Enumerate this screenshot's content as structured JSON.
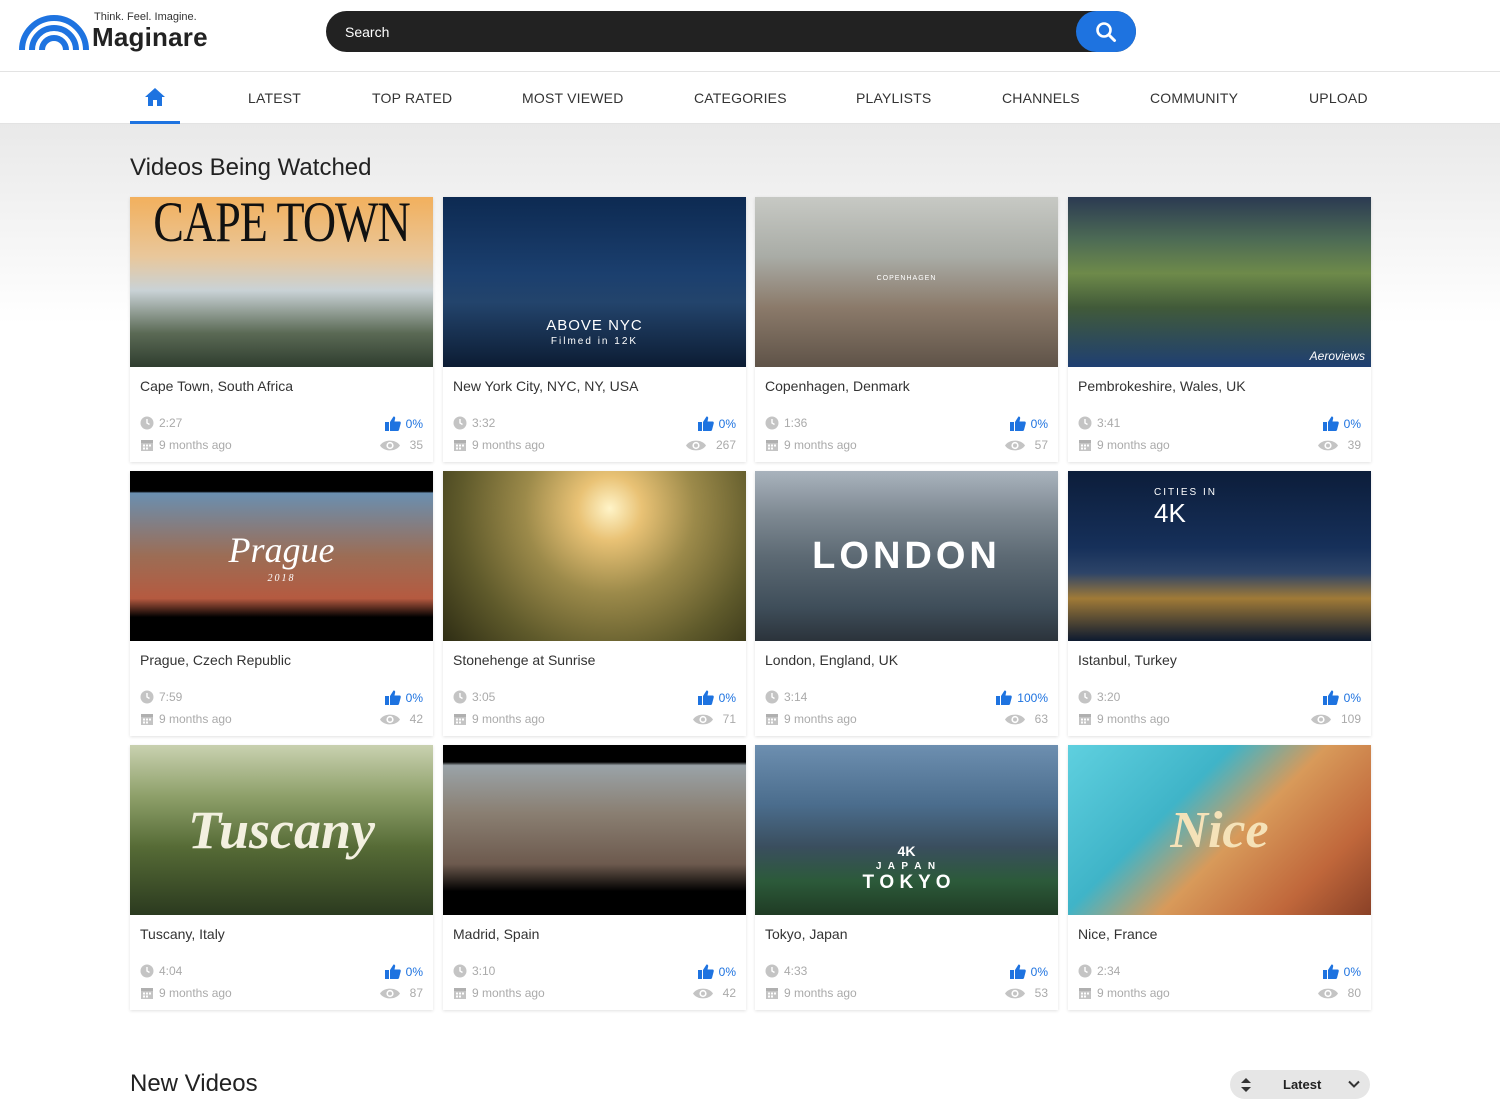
{
  "brand": {
    "tagline": "Think. Feel. Imagine.",
    "name": "Maginare",
    "color": "#1e73e0"
  },
  "search": {
    "placeholder": "Search",
    "icon": "search-icon"
  },
  "nav": {
    "home_icon": "home-icon",
    "items": [
      "LATEST",
      "TOP RATED",
      "MOST VIEWED",
      "CATEGORIES",
      "PLAYLISTS",
      "CHANNELS",
      "COMMUNITY",
      "UPLOAD"
    ]
  },
  "sections": {
    "watched_title": "Videos Being Watched",
    "new_title": "New Videos",
    "sort_value": "Latest"
  },
  "videos": [
    {
      "title": "Cape Town, South Africa",
      "duration": "2:27",
      "age": "9 months ago",
      "likes": "0%",
      "views": "35",
      "thumb_text": "CAPE TOWN"
    },
    {
      "title": "New York City, NYC, NY, USA",
      "duration": "3:32",
      "age": "9 months ago",
      "likes": "0%",
      "views": "267",
      "thumb_text": "ABOVE NYC",
      "thumb_sub": "Filmed in 12K"
    },
    {
      "title": "Copenhagen, Denmark",
      "duration": "1:36",
      "age": "9 months ago",
      "likes": "0%",
      "views": "57",
      "thumb_text": "COPENHAGEN"
    },
    {
      "title": "Pembrokeshire, Wales, UK",
      "duration": "3:41",
      "age": "9 months ago",
      "likes": "0%",
      "views": "39",
      "thumb_text": "Aeroviews"
    },
    {
      "title": "Prague, Czech Republic",
      "duration": "7:59",
      "age": "9 months ago",
      "likes": "0%",
      "views": "42",
      "thumb_text": "Prague",
      "thumb_sub": "2018"
    },
    {
      "title": "Stonehenge at Sunrise",
      "duration": "3:05",
      "age": "9 months ago",
      "likes": "0%",
      "views": "71"
    },
    {
      "title": "London, England, UK",
      "duration": "3:14",
      "age": "9 months ago",
      "likes": "100%",
      "views": "63",
      "thumb_text": "LONDON"
    },
    {
      "title": "Istanbul, Turkey",
      "duration": "3:20",
      "age": "9 months ago",
      "likes": "0%",
      "views": "109",
      "thumb_text": "4K",
      "thumb_sub": "CITIES IN"
    },
    {
      "title": "Tuscany, Italy",
      "duration": "4:04",
      "age": "9 months ago",
      "likes": "0%",
      "views": "87",
      "thumb_text": "Tuscany"
    },
    {
      "title": "Madrid, Spain",
      "duration": "3:10",
      "age": "9 months ago",
      "likes": "0%",
      "views": "42"
    },
    {
      "title": "Tokyo, Japan",
      "duration": "4:33",
      "age": "9 months ago",
      "likes": "0%",
      "views": "53",
      "thumb_text": "T O K Y O",
      "thumb_sub": "J A P A N",
      "thumb_badge": "4K"
    },
    {
      "title": "Nice, France",
      "duration": "2:34",
      "age": "9 months ago",
      "likes": "0%",
      "views": "80",
      "thumb_text": "Nice"
    }
  ]
}
